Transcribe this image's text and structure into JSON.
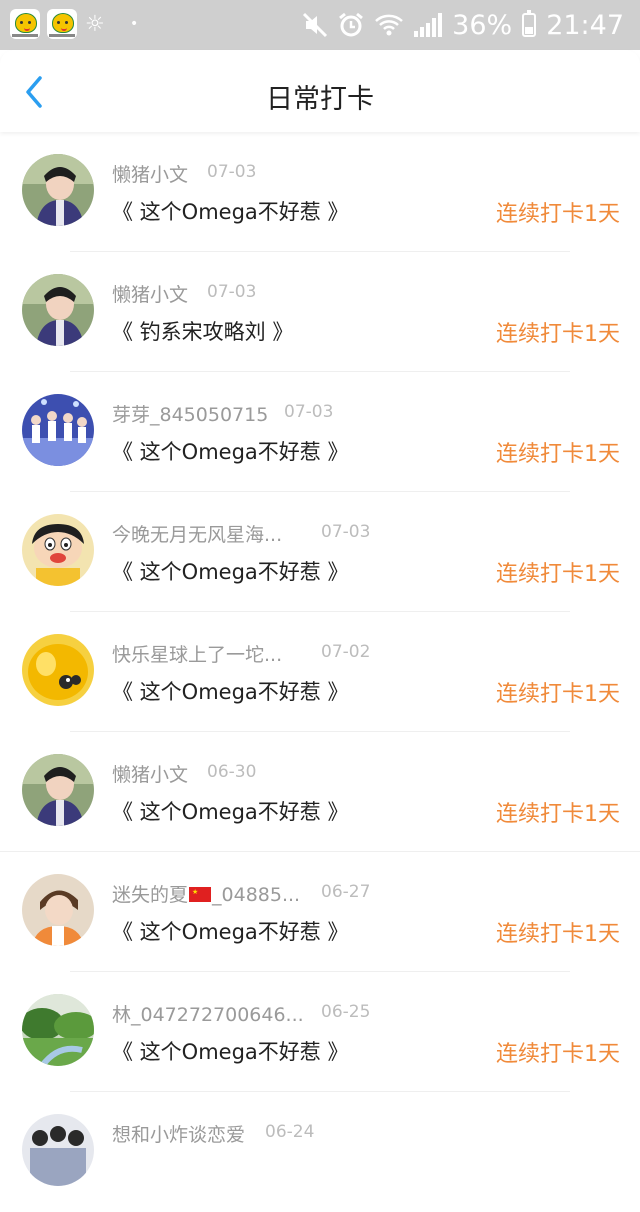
{
  "status_bar": {
    "battery": "36%",
    "time": "21:47"
  },
  "header": {
    "title": "日常打卡"
  },
  "checkins": [
    {
      "user": "懒猪小文",
      "date": "07-03",
      "book": "《 这个Omega不好惹 》",
      "streak": "连续打卡1天",
      "avatar": "photo-boy-purple"
    },
    {
      "user": "懒猪小文",
      "date": "07-03",
      "book": "《 钓系宋攻略刘 》",
      "streak": "连续打卡1天",
      "avatar": "photo-boy-purple"
    },
    {
      "user": "芽芽_845050715",
      "date": "07-03",
      "book": "《 这个Omega不好惹 》",
      "streak": "连续打卡1天",
      "avatar": "photo-group-stage"
    },
    {
      "user": "今晚无月无风星海...",
      "date": "07-03",
      "book": "《 这个Omega不好惹 》",
      "streak": "连续打卡1天",
      "avatar": "cartoon-crayon-shin"
    },
    {
      "user": "快乐星球上了一坨...",
      "date": "07-02",
      "book": "《 这个Omega不好惹 》",
      "streak": "连续打卡1天",
      "avatar": "photo-yellow-chick"
    },
    {
      "user": "懒猪小文",
      "date": "06-30",
      "book": "《 这个Omega不好惹 》",
      "streak": "连续打卡1天",
      "avatar": "photo-boy-purple"
    },
    {
      "user_prefix": "迷失的夏",
      "user_suffix": "_04885...",
      "date": "06-27",
      "book": "《 这个Omega不好惹 》",
      "streak": "连续打卡1天",
      "avatar": "photo-boy-orange"
    },
    {
      "user": "林_047272700646...",
      "date": "06-25",
      "book": "《 这个Omega不好惹 》",
      "streak": "连续打卡1天",
      "avatar": "photo-nature-green"
    },
    {
      "user": "想和小炸谈恋爱",
      "date": "06-24",
      "avatar": "photo-group"
    }
  ],
  "colors": {
    "accent_blue": "#2b9ef0",
    "streak_orange": "#f08a3a",
    "status_bar_bg": "#cfcfcf"
  },
  "icons": {
    "back": "chevron-left-icon",
    "mute": "mute-icon",
    "alarm": "alarm-icon",
    "wifi": "wifi-icon",
    "signal": "signal-icon",
    "battery": "battery-icon"
  }
}
